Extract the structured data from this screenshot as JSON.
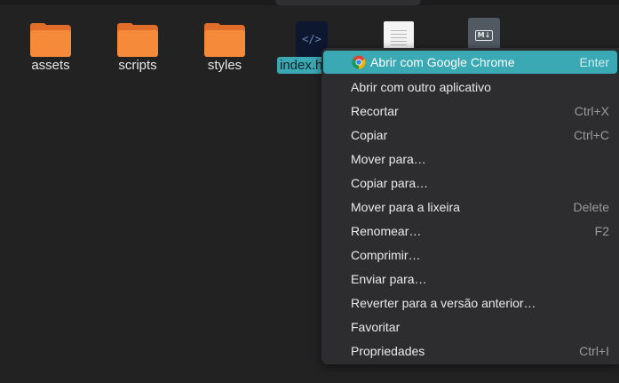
{
  "files": [
    {
      "name": "assets",
      "type": "folder",
      "icon": "folder-icon"
    },
    {
      "name": "scripts",
      "type": "folder",
      "icon": "folder-icon"
    },
    {
      "name": "styles",
      "type": "folder",
      "icon": "folder-icon"
    },
    {
      "name": "index.h",
      "type": "html",
      "icon": "html-file-icon",
      "glyph": "</>",
      "selected": true
    },
    {
      "name": "",
      "type": "text",
      "icon": "text-file-icon"
    },
    {
      "name": "",
      "type": "markdown",
      "icon": "markdown-file-icon",
      "glyph": "M↓"
    }
  ],
  "context_menu": {
    "items": [
      {
        "label": "Abrir com Google Chrome",
        "accel": "Enter",
        "icon": "chrome-icon",
        "highlighted": true
      },
      {
        "label": "Abrir com outro aplicativo",
        "accel": ""
      },
      {
        "label": "Recortar",
        "accel": "Ctrl+X"
      },
      {
        "label": "Copiar",
        "accel": "Ctrl+C"
      },
      {
        "label": "Mover para…",
        "accel": ""
      },
      {
        "label": "Copiar para…",
        "accel": ""
      },
      {
        "label": "Mover para a lixeira",
        "accel": "Delete"
      },
      {
        "label": "Renomear…",
        "accel": "F2"
      },
      {
        "label": "Comprimir…",
        "accel": ""
      },
      {
        "label": "Enviar para…",
        "accel": ""
      },
      {
        "label": "Reverter para a versão anterior…",
        "accel": ""
      },
      {
        "label": "Favoritar",
        "accel": ""
      },
      {
        "label": "Propriedades",
        "accel": "Ctrl+I"
      }
    ]
  },
  "colors": {
    "accent": "#3aa9b4",
    "folder": "#f58a3b",
    "menu_bg": "#2d2d30",
    "window_bg": "#222223"
  }
}
